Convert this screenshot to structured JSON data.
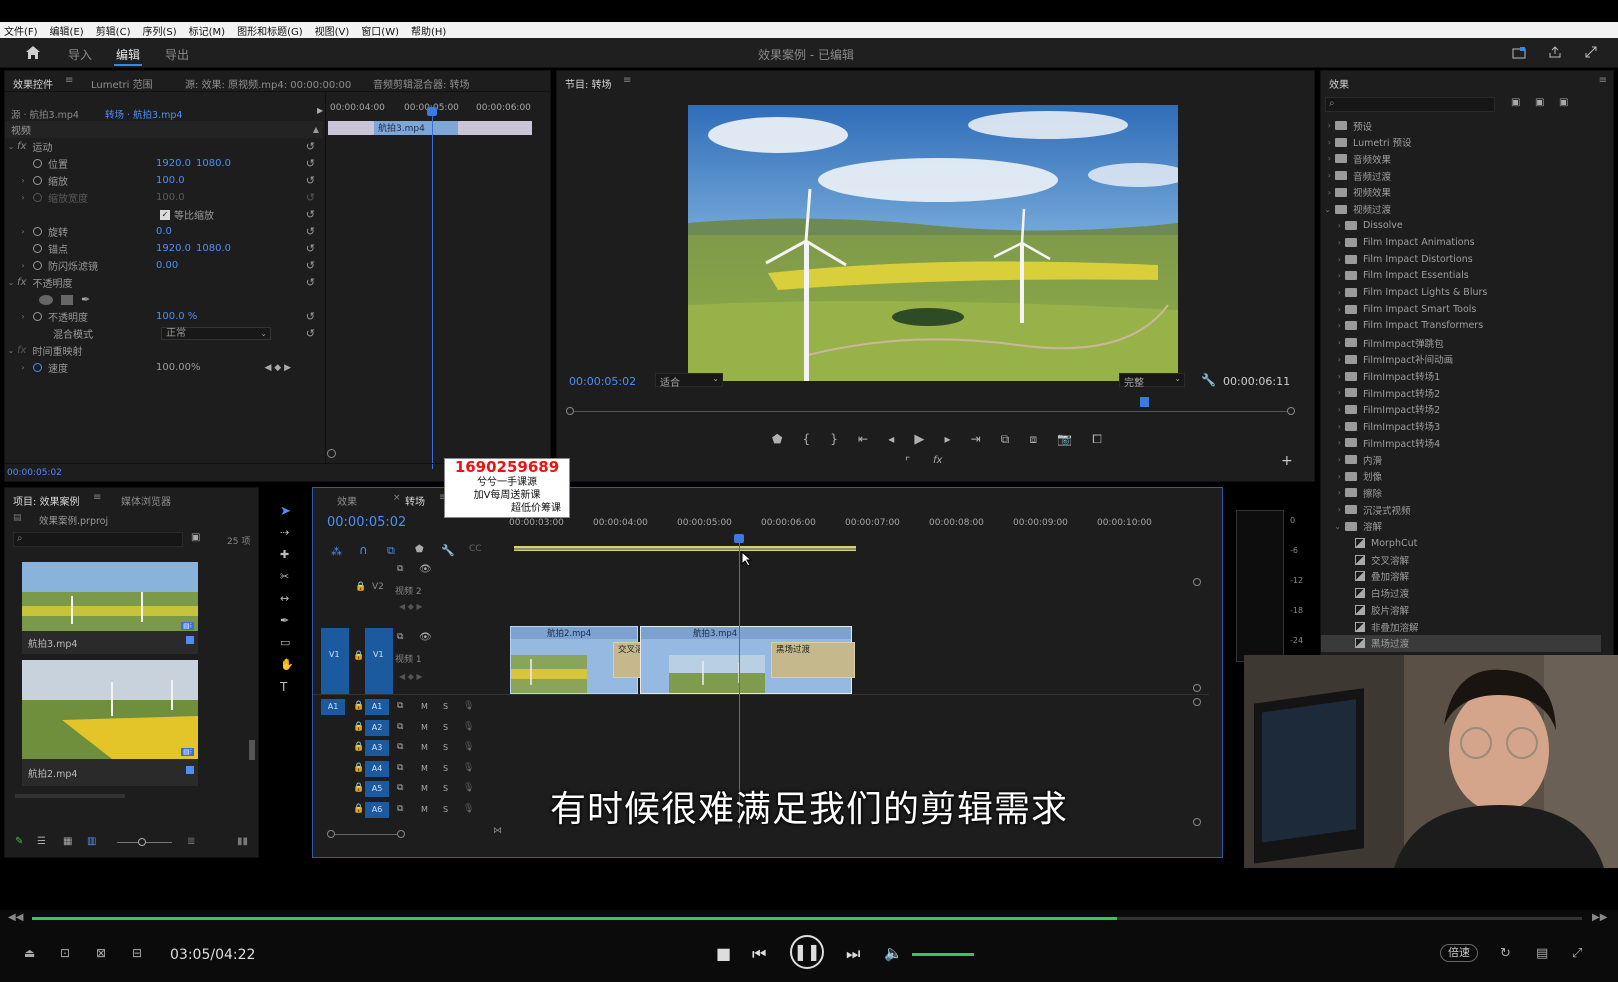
{
  "menu": [
    "文件(F)",
    "编辑(E)",
    "剪辑(C)",
    "序列(S)",
    "标记(M)",
    "图形和标题(G)",
    "视图(V)",
    "窗口(W)",
    "帮助(H)"
  ],
  "workspace": {
    "tabs": [
      "导入",
      "编辑",
      "导出"
    ],
    "active": "编辑",
    "title": "效果案例 - 已编辑"
  },
  "effect_controls": {
    "tabs": [
      "效果控件",
      "Lumetri 范围",
      "源: 效果: 原视频.mp4: 00:00:00:00",
      "音频剪辑混合器: 转场"
    ],
    "master": "源 · 航拍3.mp4",
    "clip": "转场 · 航拍3.mp4",
    "ruler": [
      "00:00:04:00",
      "00:00:05:00",
      "00:00:06:00"
    ],
    "mini_clip": "航拍3.mp4",
    "section_video": "视频",
    "fx_motion": "运动",
    "position_label": "位置",
    "position_x": "1920.0",
    "position_y": "1080.0",
    "scale_label": "缩放",
    "scale_value": "100.0",
    "scale_width_label": "缩放宽度",
    "scale_width_value": "100.0",
    "uniform_label": "等比缩放",
    "rotation_label": "旋转",
    "rotation_value": "0.0",
    "anchor_label": "锚点",
    "anchor_x": "1920.0",
    "anchor_y": "1080.0",
    "flicker_label": "防闪烁滤镜",
    "flicker_value": "0.00",
    "fx_opacity": "不透明度",
    "opacity_label": "不透明度",
    "opacity_value": "100.0 %",
    "blend_label": "混合模式",
    "blend_value": "正常",
    "time_remap": "时间重映射",
    "speed_label": "速度",
    "speed_value": "100.00%",
    "timecode": "00:00:05:02"
  },
  "program": {
    "tab": "节目: 转场",
    "timecode": "00:00:05:02",
    "fit": "适合",
    "quality": "完整",
    "duration": "00:00:06:11"
  },
  "effects_panel": {
    "title": "效果",
    "items": [
      {
        "label": "预设",
        "indent": 0
      },
      {
        "label": "Lumetri 预设",
        "indent": 0
      },
      {
        "label": "音频效果",
        "indent": 0
      },
      {
        "label": "音频过渡",
        "indent": 0
      },
      {
        "label": "视频效果",
        "indent": 0
      },
      {
        "label": "视频过渡",
        "indent": 0
      },
      {
        "label": "Dissolve",
        "indent": 1
      },
      {
        "label": "Film Impact Animations",
        "indent": 1
      },
      {
        "label": "Film Impact Distortions",
        "indent": 1
      },
      {
        "label": "Film Impact Essentials",
        "indent": 1
      },
      {
        "label": "Film Impact Lights & Blurs",
        "indent": 1
      },
      {
        "label": "Film Impact Smart Tools",
        "indent": 1
      },
      {
        "label": "Film Impact Transformers",
        "indent": 1
      },
      {
        "label": "FilmImpact弹跳包",
        "indent": 1
      },
      {
        "label": "FilmImpact补间动画",
        "indent": 1
      },
      {
        "label": "FilmImpact转场1",
        "indent": 1
      },
      {
        "label": "FilmImpact转场2",
        "indent": 1
      },
      {
        "label": "FilmImpact转场2",
        "indent": 1
      },
      {
        "label": "FilmImpact转场3",
        "indent": 1
      },
      {
        "label": "FilmImpact转场4",
        "indent": 1
      },
      {
        "label": "内滑",
        "indent": 1
      },
      {
        "label": "划像",
        "indent": 1
      },
      {
        "label": "擦除",
        "indent": 1
      },
      {
        "label": "沉浸式视频",
        "indent": 1
      },
      {
        "label": "溶解",
        "indent": 1
      },
      {
        "label": "MorphCut",
        "indent": 2
      },
      {
        "label": "交叉溶解",
        "indent": 2
      },
      {
        "label": "叠加溶解",
        "indent": 2
      },
      {
        "label": "白场过渡",
        "indent": 2
      },
      {
        "label": "胶片溶解",
        "indent": 2
      },
      {
        "label": "非叠加溶解",
        "indent": 2
      },
      {
        "label": "黑场过渡",
        "indent": 2
      }
    ]
  },
  "project": {
    "tabs": [
      "项目: 效果案例",
      "媒体浏览器"
    ],
    "file": "效果案例.prproj",
    "count": "25 项",
    "clips": [
      "航拍3.mp4",
      "航拍2.mp4"
    ]
  },
  "timeline": {
    "tabs": [
      "效果",
      "转场"
    ],
    "timecode": "00:00:05:02",
    "ruler": [
      "00:00:03:00",
      "00:00:04:00",
      "00:00:05:00",
      "00:00:06:00",
      "00:00:07:00",
      "00:00:08:00",
      "00:00:09:00",
      "00:00:10:00"
    ],
    "v2_name": "视频 2",
    "v1_name": "视频 1",
    "clip1": "航拍2.mp4",
    "clip2": "航拍3.mp4",
    "trans1": "交叉溶解",
    "trans2": "黑场过渡",
    "audio_tracks": [
      "A1",
      "A2",
      "A3",
      "A4",
      "A5",
      "A6"
    ],
    "track_m": "M",
    "track_s": "S"
  },
  "meter": [
    "0",
    "-6",
    "-12",
    "-18",
    "-24"
  ],
  "watermark": {
    "number": "1690259689",
    "line1": "兮兮一手课源",
    "line2": "加V每周送新课",
    "line3": "超低价筹课"
  },
  "subtitle": "有时候很难满足我们的剪辑需求",
  "player": {
    "time": "03:05/04:22",
    "speed": "倍速",
    "progress": 0.7
  }
}
